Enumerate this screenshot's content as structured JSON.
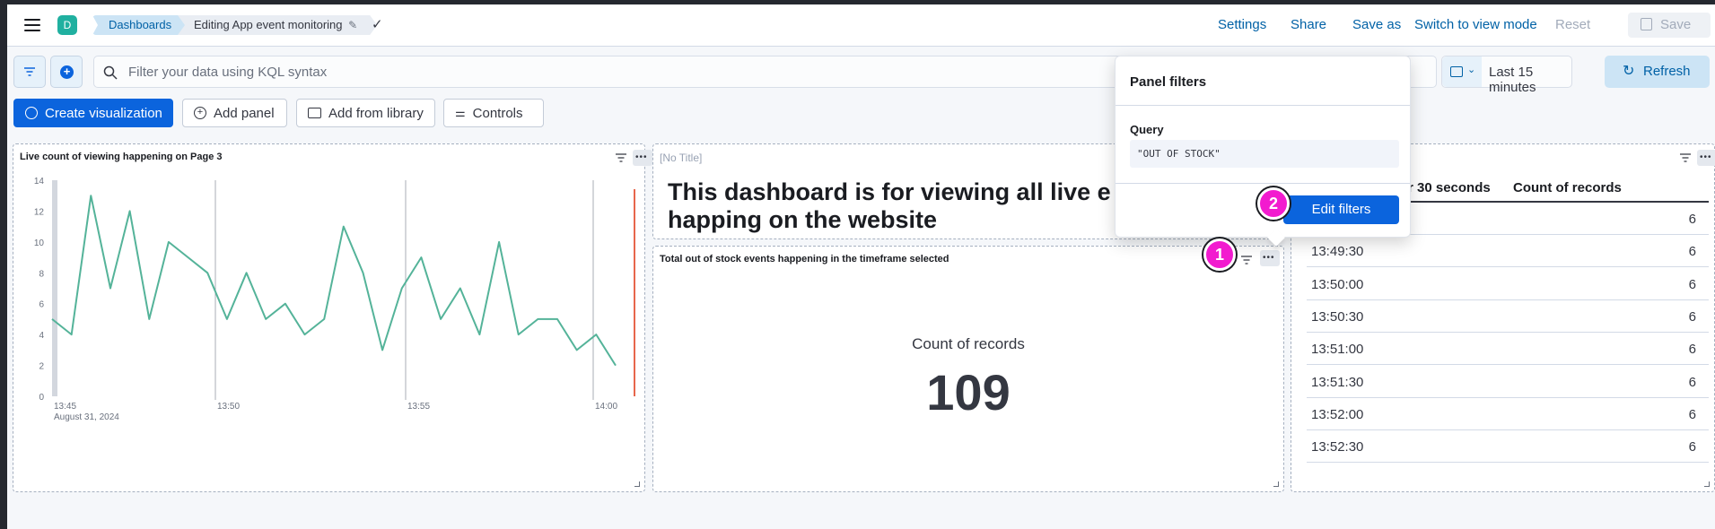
{
  "header": {
    "avatar_initial": "D",
    "breadcrumbs": [
      "Dashboards",
      "Editing App event monitoring"
    ],
    "actions": {
      "settings": "Settings",
      "share": "Share",
      "save_as": "Save as",
      "switch_view": "Switch to view mode",
      "reset": "Reset",
      "save": "Save"
    }
  },
  "query_bar": {
    "placeholder": "Filter your data using KQL syntax",
    "time_range": "Last 15 minutes",
    "refresh": "Refresh"
  },
  "toolbar": {
    "create_visualization": "Create visualization",
    "add_panel": "Add panel",
    "add_from_library": "Add from library",
    "controls": "Controls"
  },
  "panels": {
    "chart": {
      "title": "Live count of viewing happening on Page 3"
    },
    "markdown": {
      "title": "[No Title]",
      "text_line1": "This dashboard is for viewing all live e",
      "text_line2": "happing on the website"
    },
    "metric": {
      "title": "Total out of stock events happening in the timeframe selected",
      "label": "Count of records",
      "value": "109"
    },
    "table": {
      "col1": "r 30 seconds",
      "col2": "Count of records",
      "rows": [
        {
          "time": "",
          "count": "6"
        },
        {
          "time": "13:49:30",
          "count": "6"
        },
        {
          "time": "13:50:00",
          "count": "6"
        },
        {
          "time": "13:50:30",
          "count": "6"
        },
        {
          "time": "13:51:00",
          "count": "6"
        },
        {
          "time": "13:51:30",
          "count": "6"
        },
        {
          "time": "13:52:00",
          "count": "6"
        },
        {
          "time": "13:52:30",
          "count": "6"
        }
      ]
    }
  },
  "popover": {
    "title": "Panel filters",
    "query_label": "Query",
    "query_value": "\"OUT OF STOCK\"",
    "edit_button": "Edit filters"
  },
  "annotations": {
    "badge1": "1",
    "badge2": "2"
  },
  "colors": {
    "line": "#54b399",
    "now_marker": "#e7664c",
    "primary": "#0b64dd",
    "badge": "#f21bcf"
  },
  "chart_data": {
    "type": "line",
    "title": "Live count of viewing happening on Page 3",
    "x_ticks": [
      "13:45",
      "13:50",
      "13:55",
      "14:00"
    ],
    "x_subtitle": "August 31, 2024",
    "y_ticks": [
      0,
      2,
      4,
      6,
      8,
      10,
      12,
      14
    ],
    "ylim": [
      0,
      14
    ],
    "values": [
      5,
      4,
      13,
      7,
      12,
      5,
      10,
      9,
      8,
      5,
      8,
      5,
      6,
      4,
      5,
      11,
      8,
      3,
      7,
      9,
      5,
      7,
      4,
      10,
      4,
      5,
      5,
      3,
      4,
      2
    ]
  }
}
